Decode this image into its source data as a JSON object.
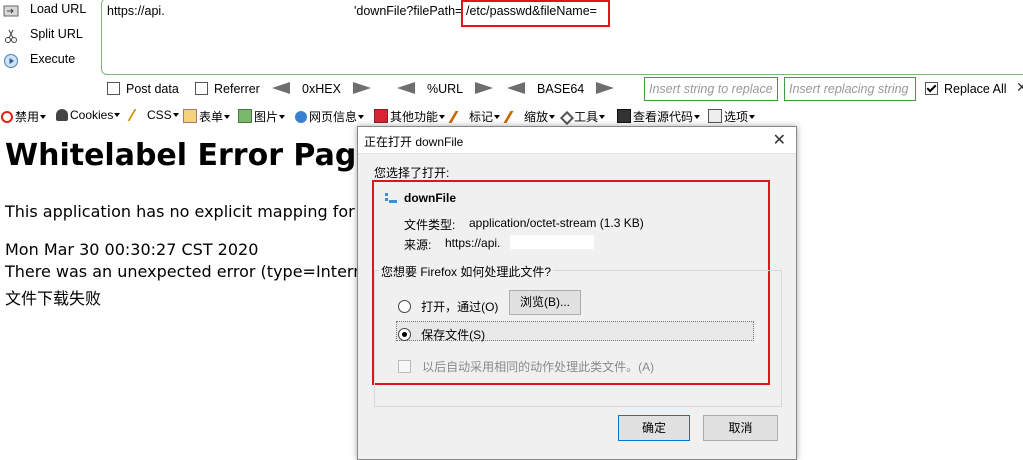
{
  "hackbar": {
    "load_url": "Load URL",
    "split_url": "Split URL",
    "execute": "Execute",
    "url_part1": "https://api.",
    "url_part2": "'downFile?filePath=",
    "url_highlight": "/etc/passwd&fileName=",
    "post_data": "Post data",
    "referrer": "Referrer",
    "hex": "0xHEX",
    "url_enc": "%URL",
    "base64": "BASE64",
    "insert_placeholder": "Insert string to replace",
    "replacing_placeholder": "Insert replacing string",
    "replace_all": "Replace All"
  },
  "toolbar": {
    "items": [
      "禁用",
      "Cookies",
      "CSS",
      "表单",
      "图片",
      "网页信息",
      "其他功能",
      "标记",
      "缩放",
      "工具",
      "查看源代码",
      "选项"
    ]
  },
  "page": {
    "title": "Whitelabel Error Page",
    "line1": "This application has no explicit mapping for /e",
    "line2": "Mon Mar 30 00:30:27 CST 2020",
    "line3": "There was an unexpected error (type=Internal",
    "line4": "文件下载失败"
  },
  "dialog": {
    "title": "正在打开 downFile",
    "close": "✕",
    "you_chose": "您选择了打开:",
    "file_name": "downFile",
    "type_label": "文件类型:",
    "type_value": "application/octet-stream (1.3 KB)",
    "source_label": "来源:",
    "source_value": "https://api.",
    "question": "您想要 Firefox 如何处理此文件?",
    "open_with": "打开，通过(O)",
    "browse": "浏览(B)...",
    "save_file": "保存文件(S)",
    "auto": "以后自动采用相同的动作处理此类文件。(A)",
    "ok": "确定",
    "cancel": "取消"
  },
  "colors": {
    "highlight_red": "#e0141c",
    "hackbar_green": "#3c9e3c"
  }
}
